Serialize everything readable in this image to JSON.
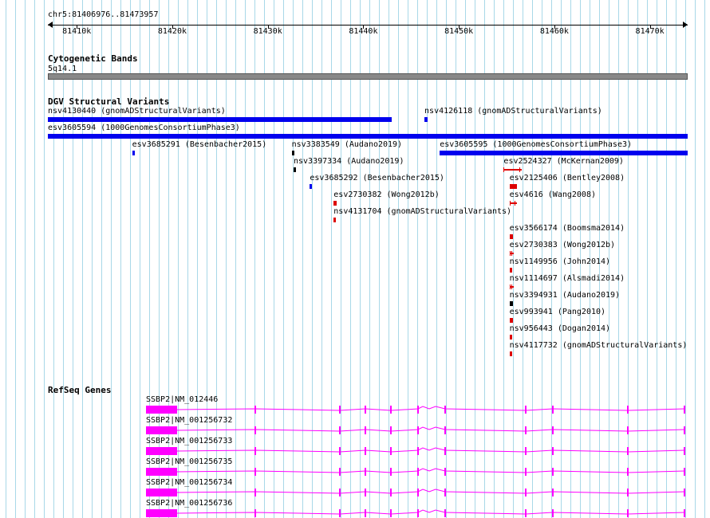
{
  "location": "chr5:81406976..81473957",
  "ruler": {
    "ticks": [
      {
        "label": "81410k",
        "pos": 81410000
      },
      {
        "label": "81420k",
        "pos": 81420000
      },
      {
        "label": "81430k",
        "pos": 81430000
      },
      {
        "label": "81440k",
        "pos": 81440000
      },
      {
        "label": "81450k",
        "pos": 81450000
      },
      {
        "label": "81460k",
        "pos": 81460000
      },
      {
        "label": "81470k",
        "pos": 81470000
      }
    ]
  },
  "view": {
    "start": 81406976,
    "end": 81473957
  },
  "colors": {
    "blue": "#0000ee",
    "red": "#dd0000",
    "black": "#000000",
    "magenta": "#ff00ff",
    "band": "#888888"
  },
  "tracks": {
    "cytoband": {
      "title": "Cytogenetic Bands",
      "band_label": "5q14.1"
    },
    "dgv": {
      "title": "DGV Structural Variants",
      "features": [
        {
          "label": "nsv4130440 (gnomADStructuralVariants)",
          "start": 81406976,
          "end": 81443000,
          "row": 0,
          "color": "blue",
          "thick": 6
        },
        {
          "label": "nsv4126118 (gnomADStructuralVariants)",
          "start": 81446400,
          "end": 81446700,
          "row": 0,
          "color": "blue",
          "thick": 6,
          "labelAt": 81446400
        },
        {
          "label": "esv3605594 (1000GenomesConsortiumPhase3)",
          "start": 81406976,
          "end": 81473957,
          "row": 1,
          "color": "blue",
          "thick": 6
        },
        {
          "label": "esv3685291 (Besenbacher2015)",
          "start": 81415800,
          "end": 81416050,
          "row": 2,
          "color": "blue",
          "thick": 6
        },
        {
          "label": "nsv3383549 (Audano2019)",
          "start": 81432500,
          "end": 81432700,
          "row": 2,
          "color": "black",
          "thick": 6
        },
        {
          "label": "esv3605595 (1000GenomesConsortiumPhase3)",
          "start": 81448000,
          "end": 81473957,
          "row": 2,
          "color": "blue",
          "thick": 6
        },
        {
          "label": "nsv3397334 (Audano2019)",
          "start": 81432700,
          "end": 81432900,
          "row": 3,
          "color": "black",
          "thick": 6
        },
        {
          "label": "esv2524327 (McKernan2009)",
          "start": 81454700,
          "end": 81456400,
          "row": 3,
          "color": "red",
          "thick": 2,
          "whisker": true
        },
        {
          "label": "esv3685292 (Besenbacher2015)",
          "start": 81434400,
          "end": 81434600,
          "row": 4,
          "color": "blue",
          "thick": 6
        },
        {
          "label": "esv2125406 (Bentley2008)",
          "start": 81455300,
          "end": 81456100,
          "row": 4,
          "color": "red",
          "thick": 6
        },
        {
          "label": "esv2730382 (Wong2012b)",
          "start": 81436900,
          "end": 81437200,
          "row": 5,
          "color": "red",
          "thick": 6
        },
        {
          "label": "esv4616 (Wang2008)",
          "start": 81455300,
          "end": 81455900,
          "row": 5,
          "color": "red",
          "thick": 2,
          "whisker": true
        },
        {
          "label": "nsv4131704 (gnomADStructuralVariants)",
          "start": 81436900,
          "end": 81437050,
          "row": 6,
          "color": "red",
          "thick": 6
        },
        {
          "label": "esv3566174 (Boomsma2014)",
          "start": 81455300,
          "end": 81455700,
          "row": 7,
          "color": "red",
          "thick": 6
        },
        {
          "label": "esv2730383 (Wong2012b)",
          "start": 81455300,
          "end": 81455600,
          "row": 8,
          "color": "red",
          "thick": 2,
          "whisker": true
        },
        {
          "label": "nsv1149956 (John2014)",
          "start": 81455300,
          "end": 81455600,
          "row": 9,
          "color": "red",
          "thick": 6
        },
        {
          "label": "nsv1114697 (Alsmadi2014)",
          "start": 81455300,
          "end": 81455600,
          "row": 10,
          "color": "red",
          "thick": 2,
          "whisker": true
        },
        {
          "label": "nsv3394931 (Audano2019)",
          "start": 81455300,
          "end": 81455700,
          "row": 11,
          "color": "black",
          "thick": 6
        },
        {
          "label": "esv993941 (Pang2010)",
          "start": 81455300,
          "end": 81455700,
          "row": 12,
          "color": "red",
          "thick": 6
        },
        {
          "label": "nsv956443 (Dogan2014)",
          "start": 81455300,
          "end": 81455600,
          "row": 13,
          "color": "red",
          "thick": 6
        },
        {
          "label": "nsv4117732 (gnomADStructuralVariants)",
          "start": 81455300,
          "end": 81455600,
          "row": 14,
          "color": "red",
          "thick": 6
        }
      ]
    },
    "refseq": {
      "title": "RefSeq Genes",
      "genes": [
        {
          "label": "SSBP2|NM_012446"
        },
        {
          "label": "SSBP2|NM_001256732"
        },
        {
          "label": "SSBP2|NM_001256733"
        },
        {
          "label": "SSBP2|NM_001256735"
        },
        {
          "label": "SSBP2|NM_001256734"
        },
        {
          "label": "SSBP2|NM_001256736"
        }
      ]
    }
  }
}
